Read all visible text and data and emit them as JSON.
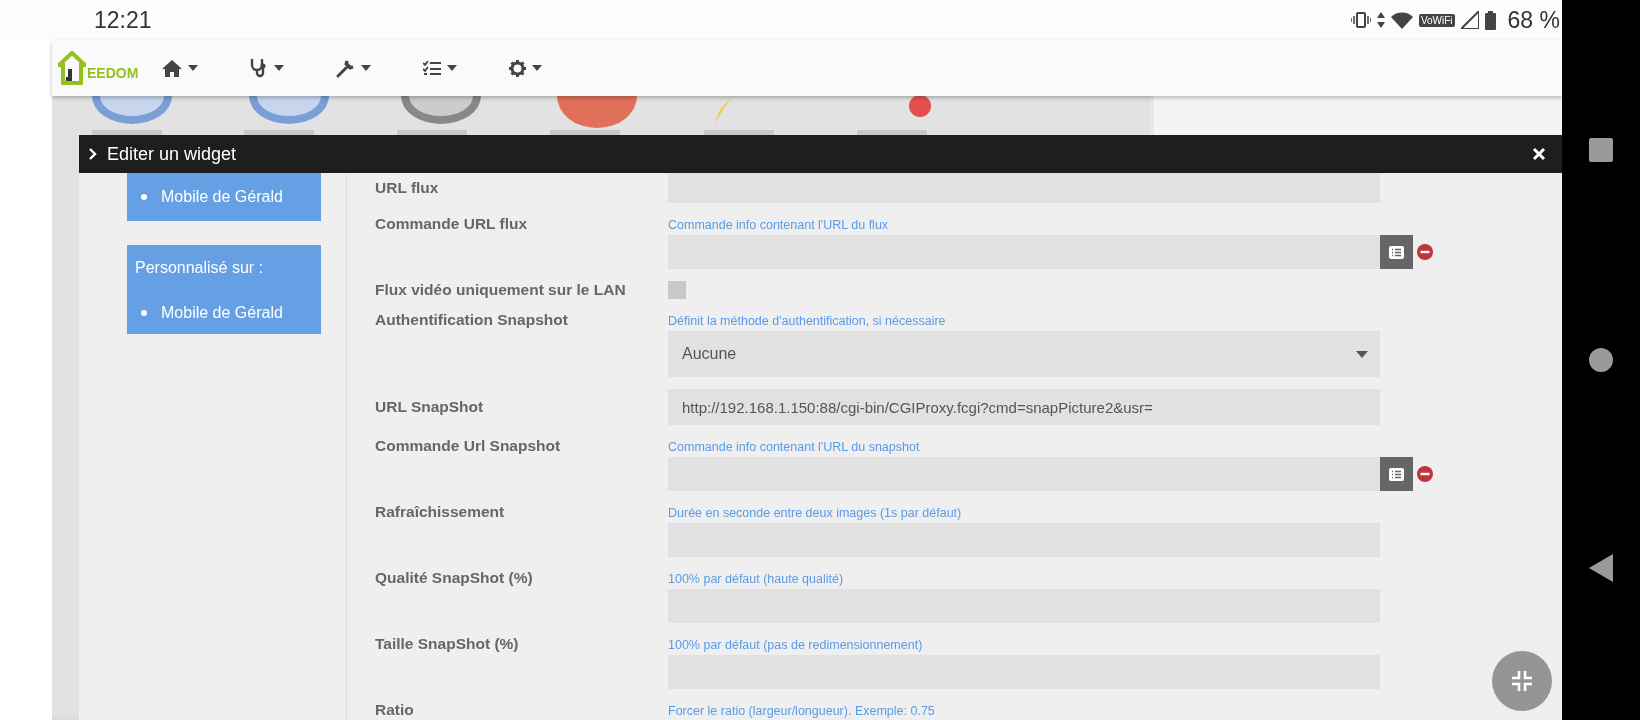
{
  "status_bar": {
    "time": "12:21",
    "network_label": "VoWiFi",
    "battery": "68 %"
  },
  "navbar": {
    "logo": "EEDOM",
    "menus": [
      {
        "kind": "home"
      },
      {
        "kind": "health"
      },
      {
        "kind": "tools"
      },
      {
        "kind": "tasks"
      },
      {
        "kind": "settings"
      }
    ]
  },
  "modal": {
    "title": "Editer un widget",
    "sidebar": [
      {
        "items": [
          "Mobile de Gérald"
        ]
      },
      {
        "heading": "Personnalisé sur :",
        "items": [
          "Mobile de Gérald"
        ]
      }
    ],
    "rows": [
      {
        "label": "URL flux",
        "kind": "text"
      },
      {
        "label": "Commande URL flux",
        "hint": "Commande info contenant l'URL du flux",
        "kind": "command"
      },
      {
        "label": "Flux vidéo uniquement sur le LAN",
        "kind": "checkbox",
        "checked": false
      },
      {
        "label": "Authentification Snapshot",
        "hint": "Définit la méthode d'authentification, si nécessaire",
        "kind": "select",
        "value": "Aucune"
      },
      {
        "label": "URL SnapShot",
        "kind": "text",
        "value": "http://192.168.1.150:88/cgi-bin/CGIProxy.fcgi?cmd=snapPicture2&usr="
      },
      {
        "label": "Commande Url Snapshot",
        "hint": "Commande info contenant l'URL du snapshot",
        "kind": "command"
      },
      {
        "label": "Rafraîchissement",
        "hint": "Durée en seconde entre deux images (1s par défaut)",
        "kind": "text"
      },
      {
        "label": "Qualité SnapShot (%)",
        "hint": "100% par défaut (haute qualité)",
        "kind": "text"
      },
      {
        "label": "Taille SnapShot (%)",
        "hint": "100% par défaut (pas de redimensionnement)",
        "kind": "text"
      },
      {
        "label": "Ratio",
        "hint": "Forcer le ratio (largeur/longueur). Exemple: 0.75"
      }
    ]
  }
}
